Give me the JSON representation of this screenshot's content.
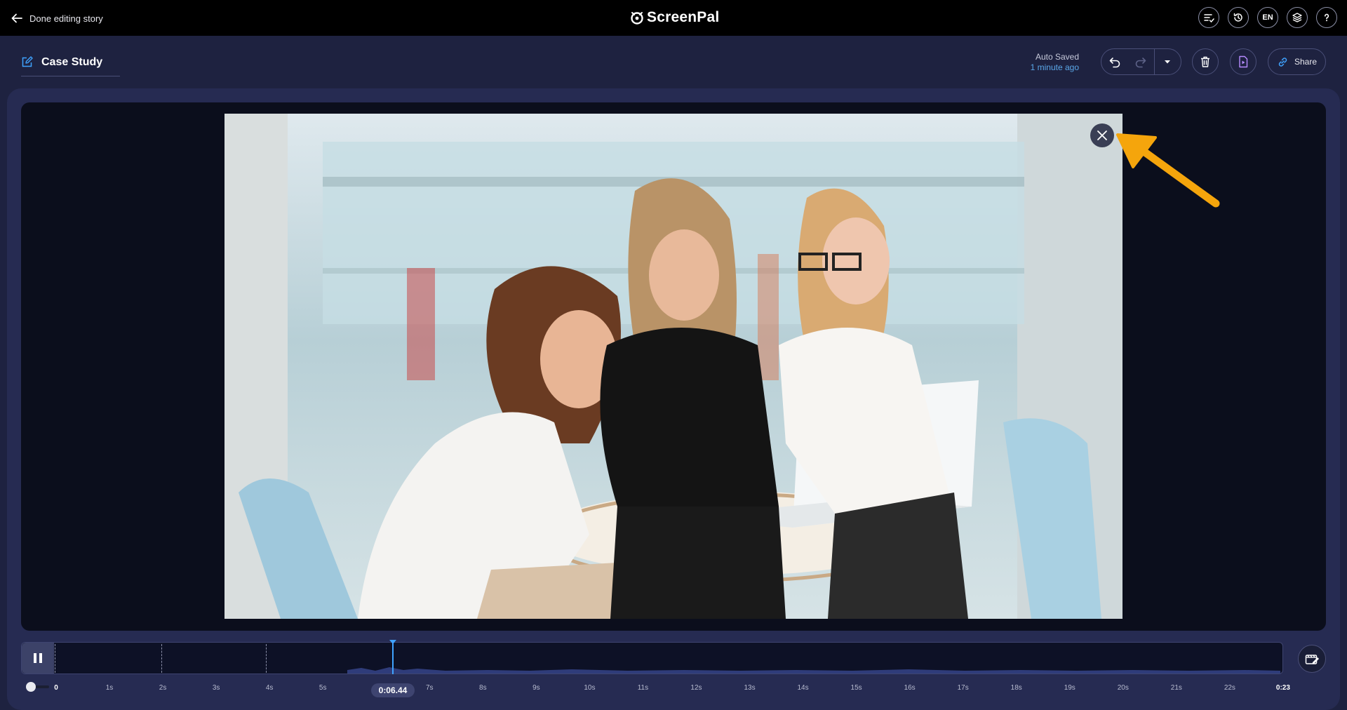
{
  "topbar": {
    "back_label": "Done editing story",
    "logo_prefix": "Screen",
    "logo_suffix": "Pal",
    "language": "EN"
  },
  "header": {
    "title": "Case Study",
    "autosave_status": "Auto Saved",
    "autosave_time": "1 minute ago",
    "share_label": "Share"
  },
  "player": {
    "current_time": "0:06.44",
    "timeline_ticks": [
      "0",
      "1s",
      "2s",
      "3s",
      "4s",
      "5s",
      "6s",
      "7s",
      "8s",
      "9s",
      "10s",
      "11s",
      "12s",
      "13s",
      "14s",
      "15s",
      "16s",
      "17s",
      "18s",
      "19s",
      "20s",
      "21s",
      "22s",
      "0:23"
    ]
  },
  "colors": {
    "accent": "#3fa3ff",
    "arrow": "#f5a50c",
    "background": "#1e2240"
  },
  "icons": {
    "back": "arrow-left-icon",
    "checklist": "checklist-icon",
    "history": "history-icon",
    "layers": "layers-icon",
    "help": "help-icon",
    "edit": "edit-icon",
    "undo": "undo-icon",
    "redo": "redo-icon",
    "dropdown": "chevron-down-icon",
    "trash": "trash-icon",
    "export": "export-video-icon",
    "link": "link-icon",
    "close": "close-icon",
    "pause": "pause-icon",
    "clip": "clip-icon"
  }
}
